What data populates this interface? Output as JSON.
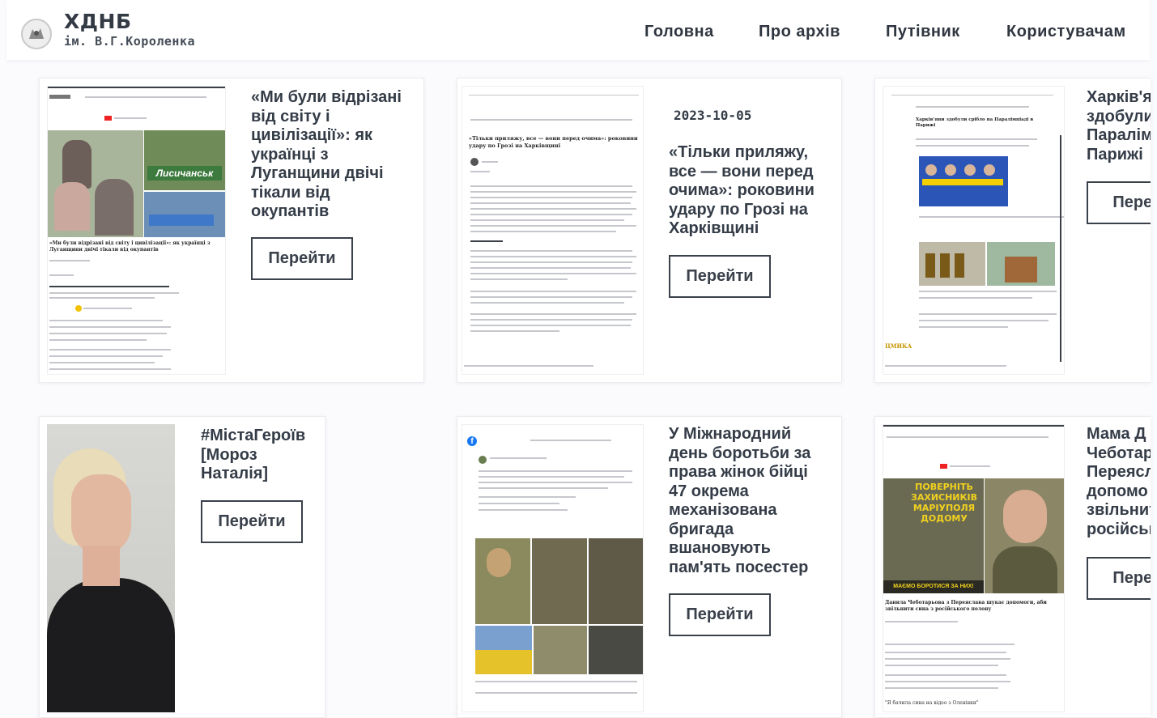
{
  "header": {
    "logo_title": "ХДНБ",
    "logo_subtitle": "ім. В.Г.Короленка",
    "nav": [
      "Головна",
      "Про архів",
      "Путівник",
      "Користувачам"
    ]
  },
  "cards": [
    {
      "title": "«Ми були відрізані\nвід світу і\nцивілізації»: як\nукраїнці з\nЛуганщини двічі\nтікали від\nокупантів",
      "button": "Перейти"
    },
    {
      "date": "2023-10-05",
      "title": "«Тільки приляжу,\nвсе — вони перед\nочима»: роковини\nудару по Грозі на\nХарківщині",
      "button": "Перейти"
    },
    {
      "title": "Харків'я\nздобули\nПаралім\nПарижі",
      "button": "Перей"
    },
    {
      "title": "#МістаГероїв\n[Мороз\nНаталія]",
      "button": "Перейти"
    },
    {
      "title": "У Міжнародний\nдень боротьби за\nправа жінок бійці\n47 окрема\nмеханізована\nбригада\nвшановують\nпам'ять посестер",
      "button": "Перейти"
    },
    {
      "title": "Мама Д\nЧеботар\nПереясл\nдопомо\nзвільнит\nросійськ",
      "button": "Перей"
    }
  ],
  "thumb_texts": {
    "t1_headline": "«Ми були відрізані від світу і цивілізації»: як українці з Луганщини двічі тікали від окупантів",
    "t1_sign": "Лисичанськ",
    "t2_headline": "«Тільки приляжу, все — вони перед очима»: роковини удару по Грозі на Харківщині",
    "t3_headline": "Харків'яни здобули срібло на Паралімпіаді в Парижі",
    "t3_logo": "ЦМИКА",
    "t6_banner": "ПОВЕРНІТЬ ЗАХИСНИКІВ МАРІУПОЛЯ ДОДОМУ",
    "t6_caption": "МАЄМО БОРОТИСЯ ЗА НИХ!",
    "t6_headline": "Данила Чеботарьова з Переяслава шукає допомоги, аби звільнити сина з російського полону",
    "t6_quote": "\"Я бачила сина на відео з Оленівки\""
  },
  "colors": {
    "background": "#fbfafc",
    "text": "#343c47",
    "button_border": "#3a414b",
    "header_bg": "#ffffff"
  },
  "icons": [
    "library-logo-icon",
    "facebook-icon",
    "youtube-icon"
  ]
}
